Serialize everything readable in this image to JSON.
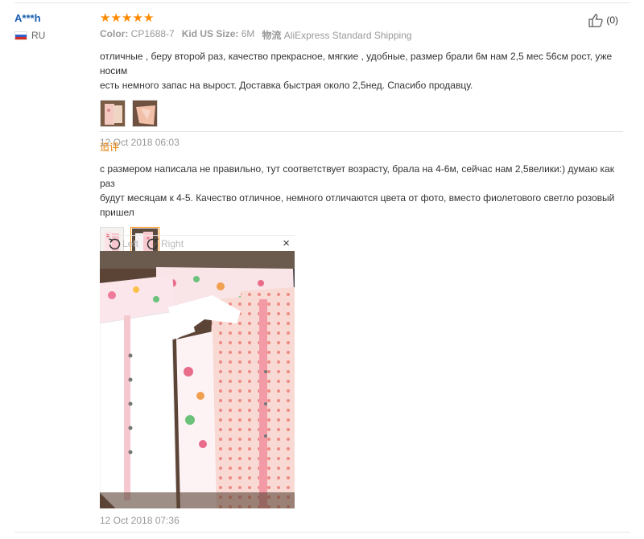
{
  "review1": {
    "buyer_name": "A***h",
    "country": "RU",
    "like_count": "(0)",
    "color_label": "Color:",
    "color_value": "CP1688-7",
    "size_label": "Kid US Size:",
    "size_value": "6M",
    "shipping_label": "物流",
    "shipping_value": "AliExpress Standard Shipping",
    "text_line1": "отличные , беру второй раз, качество прекрасное, мягкие , удобные, размер брали 6м нам 2,5 мес 56см рост, уже носим",
    "text_line2": "есть немного запас на вырост. Доставка быстрая около 2,5нед. Спасибо продавцу.",
    "date": "12 Oct 2018 06:03",
    "rating": 5
  },
  "followup": {
    "title": "追评",
    "text_line1": "с размером написала не правильно, тут соответствует возрасту, брала на 4-6м, сейчас нам 2,5велики:) думаю как раз",
    "text_line2": "будут месяцам к 4-5. Качество отличное, немного отличаются цвета от фото, вместо фиолетового светло розовый",
    "text_line3": "пришел",
    "date": "12 Oct 2018 07:36"
  },
  "viewer": {
    "left_label": "Left",
    "right_label": "Right",
    "close_glyph": "×"
  },
  "icons": {
    "star": "star-icon",
    "like": "thumbs-up-icon",
    "flag": "russia-flag-icon",
    "rotate_left": "rotate-left-icon",
    "rotate_right": "rotate-right-icon",
    "close": "close-icon"
  },
  "colors": {
    "star": "#ff8a00",
    "name": "#1a5db0",
    "followup_title": "#e67e00",
    "selected_thumb_border": "#ff8a00"
  }
}
